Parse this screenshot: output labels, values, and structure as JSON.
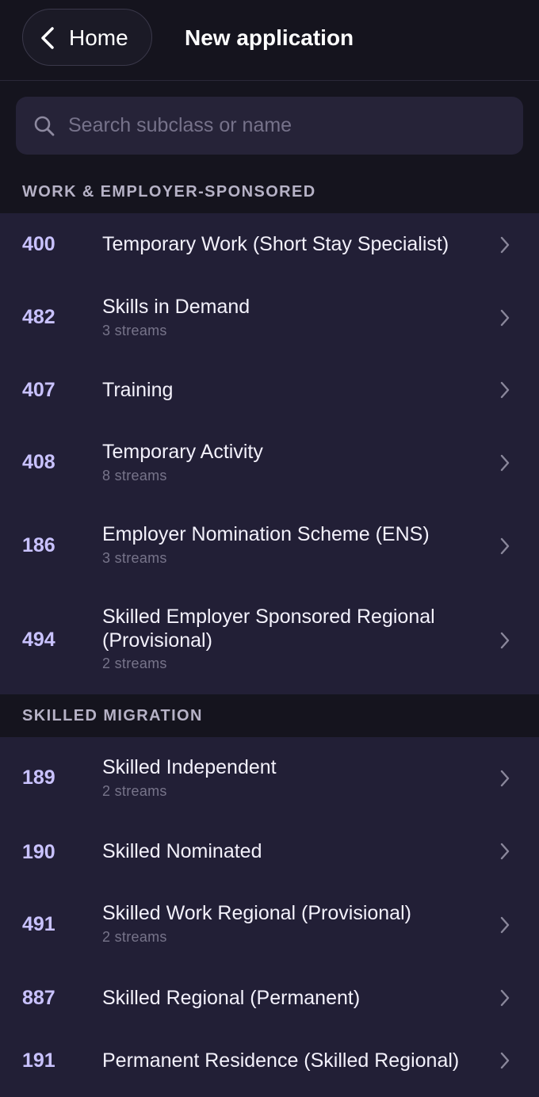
{
  "header": {
    "back_label": "Home",
    "title": "New application"
  },
  "search": {
    "placeholder": "Search subclass or name",
    "value": ""
  },
  "sections": [
    {
      "title": "WORK & EMPLOYER-SPONSORED",
      "items": [
        {
          "code": "400",
          "title": "Temporary Work (Short Stay Specialist)",
          "sub": ""
        },
        {
          "code": "482",
          "title": "Skills in Demand",
          "sub": "3 streams"
        },
        {
          "code": "407",
          "title": "Training",
          "sub": ""
        },
        {
          "code": "408",
          "title": "Temporary Activity",
          "sub": "8 streams"
        },
        {
          "code": "186",
          "title": "Employer Nomination Scheme (ENS)",
          "sub": "3 streams"
        },
        {
          "code": "494",
          "title": "Skilled Employer Sponsored Regional (Provisional)",
          "sub": "2 streams"
        }
      ]
    },
    {
      "title": "SKILLED MIGRATION",
      "items": [
        {
          "code": "189",
          "title": "Skilled Independent",
          "sub": "2 streams"
        },
        {
          "code": "190",
          "title": "Skilled Nominated",
          "sub": ""
        },
        {
          "code": "491",
          "title": "Skilled Work Regional (Provisional)",
          "sub": "2 streams"
        },
        {
          "code": "887",
          "title": "Skilled Regional (Permanent)",
          "sub": ""
        },
        {
          "code": "191",
          "title": "Permanent Residence (Skilled Regional)",
          "sub": ""
        }
      ]
    }
  ],
  "colors": {
    "background": "#15141e",
    "list_background": "#221f36",
    "code_accent": "#c9c2ff",
    "secondary_text": "#77748a"
  },
  "icons": {
    "back": "chevron-left-icon",
    "search": "search-icon",
    "row_arrow": "chevron-right-icon"
  }
}
